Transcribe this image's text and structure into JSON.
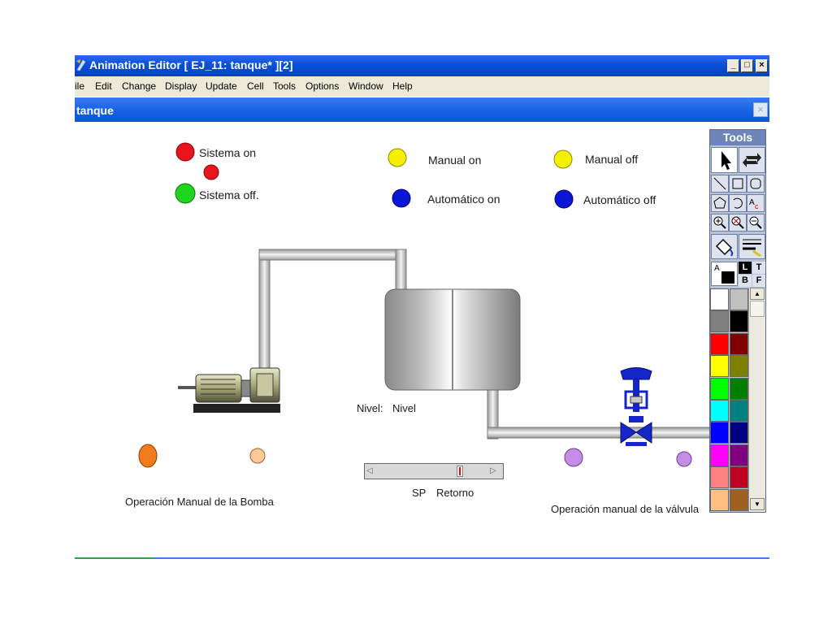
{
  "window": {
    "title": "Animation Editor [ EJ_11: tanque* ][2]",
    "min_label": "_",
    "restore_label": "□",
    "close_label": "×"
  },
  "menu": {
    "items": [
      "ile",
      "Edit",
      "Change",
      "Display",
      "Update",
      "Cell",
      "Tools",
      "Options",
      "Window",
      "Help"
    ]
  },
  "child": {
    "title": "tanque",
    "close_label": "×"
  },
  "indicators": {
    "sistema_on": "Sistema on",
    "sistema_off": "Sistema off.",
    "manual_on": "Manual on",
    "manual_off": "Manual off",
    "auto_on": "Automático on",
    "auto_off": "Automático off"
  },
  "process": {
    "nivel_label": "Nivel:",
    "nivel_value": "Nivel",
    "sp_label": "SP",
    "sp_value": "Retorno",
    "bomba_label": "Operación Manual de la Bomba",
    "valvula_label": "Operación manual de la válvula"
  },
  "tools": {
    "title": "Tools",
    "letters": [
      "L",
      "T",
      "B",
      "F"
    ],
    "colors": [
      "#ffffff",
      "#c0c0c0",
      "#808080",
      "#000000",
      "#ff0000",
      "#800000",
      "#ffff00",
      "#808000",
      "#00ff00",
      "#008000",
      "#00ffff",
      "#008080",
      "#0000ff",
      "#000080",
      "#ff00ff",
      "#800080",
      "#ff8080",
      "#c00020",
      "#ffc080",
      "#a06020"
    ]
  },
  "colors": {
    "red": "#e8151f",
    "green": "#1fd41f",
    "yellow": "#f5f000",
    "blue": "#0a16d6",
    "orange": "#f07c1c",
    "peach": "#fbc99a",
    "purple": "#c48ee8"
  }
}
